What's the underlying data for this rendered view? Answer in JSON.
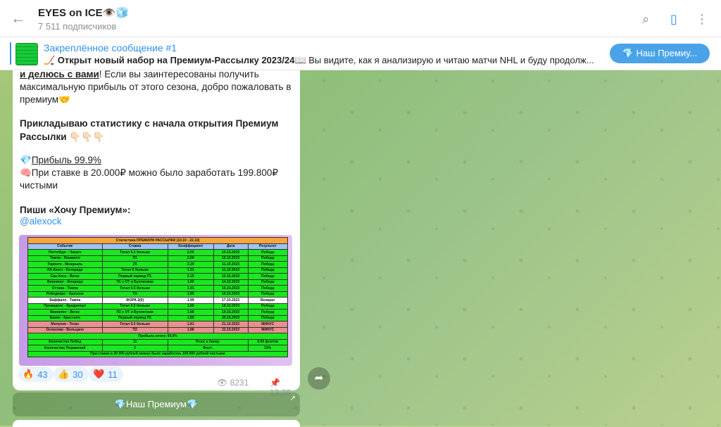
{
  "header": {
    "title": "EYES on ICE👁️🧊",
    "subscribers": "7 511 подписчиков",
    "icons": [
      "back-arrow-icon",
      "search-icon",
      "sidebar-panel-icon",
      "more-vertical-icon"
    ]
  },
  "pinned": {
    "title": "Закреплённое сообщение #1",
    "text_bold": "🏒 Открыт новый набор на Премиум-Рассылку 2023/24📖",
    "text_rest": " Вы видите, как я анализирую и читаю матчи NHL и буду продолж...",
    "button": "💎 Наш Премиу..."
  },
  "message": {
    "line1_bold": "и делюсь с вами",
    "line1_rest": "!  Если вы заинтересованы получить",
    "line2": "максимальную прибыль от этого сезона, добро пожаловать в",
    "line3": "премиум🤝",
    "line4": "Прикладываю статистику с начала открытия Премиум",
    "line5": "Рассылки 👇🏻👇🏻👇🏻",
    "profit_emoji": "💎",
    "profit_text": "Прибыль 99.9%",
    "bet_line1": "🧠При ставке в 20.000₽ можно было заработать 199.800₽",
    "bet_line2": "чистыми",
    "cta": "Пиши «Хочу Премиум»:",
    "handle": "@alexock"
  },
  "stats_table": {
    "title": "Статистика ПРЕМИУМ РАССЫЛКИ (10.10 - 22.10)",
    "columns": [
      "Событие",
      "Ставка",
      "Коэффициент",
      "Дата",
      "Результат"
    ],
    "rows": [
      {
        "event": "Питтсбург - Чикаго",
        "bet": "Тотал 6.5 больше",
        "coef": "2.00",
        "date": "10.10.2023",
        "result": "Победа",
        "kind": "g"
      },
      {
        "event": "Тампа - Нэшвилл",
        "bet": "П1",
        "coef": "2.09",
        "date": "10.10.2023",
        "result": "Победа",
        "kind": "g"
      },
      {
        "event": "Торонто - Монреаль",
        "bet": "2Х",
        "coef": "2.20",
        "date": "11.10.2023",
        "result": "Победа",
        "kind": "g"
      },
      {
        "event": "ЛА Кингз - Колорадо",
        "bet": "Тотал 6 больше",
        "coef": "1.91",
        "date": "11.10.2023",
        "result": "Победа",
        "kind": "g"
      },
      {
        "event": "Сан-Хосе - Вегас",
        "bet": "Первый период П1",
        "coef": "2.15",
        "date": "12.10.2023",
        "result": "Победа",
        "kind": "g"
      },
      {
        "event": "Виннипег - Флорида",
        "bet": "П1 с ОТ и Буллитами",
        "coef": "1.80",
        "date": "14.10.2023",
        "result": "Победа",
        "kind": "g"
      },
      {
        "event": "Оттава - Тампа",
        "bet": "Тотал 6.5 больше",
        "coef": "1.91",
        "date": "15.10.2023",
        "result": "Победа",
        "kind": "g"
      },
      {
        "event": "Рейнджерс - Аризона",
        "bet": "П1",
        "coef": "1.80",
        "date": "16.10.2023",
        "result": "Победа",
        "kind": "g"
      },
      {
        "event": "Баффало - Тампа",
        "bet": "ФОРА 2(0)",
        "coef": "1.99",
        "date": "17.10.2023",
        "result": "Возврат",
        "kind": "w"
      },
      {
        "event": "Провиденс - Бриджпорт",
        "bet": "Тотал 5.5 больше",
        "coef": "1.85",
        "date": "18.10.2023",
        "result": "Победа",
        "kind": "g"
      },
      {
        "event": "Виннипег - Вегас",
        "bet": "П2 с ОТ и Буллитами",
        "coef": "1.88",
        "date": "19.10.2023",
        "result": "Победа",
        "kind": "g"
      },
      {
        "event": "Бакин - Кристалл",
        "bet": "Первый период П1",
        "coef": "1.80",
        "date": "20.10.2023",
        "result": "Победа",
        "kind": "g"
      },
      {
        "event": "Милуоки - Техас",
        "bet": "Тотал 5.5 больше",
        "coef": "1.81",
        "date": "21.10.2023",
        "result": "МИНУС",
        "kind": "r"
      },
      {
        "event": "Оклахома - Вольцано",
        "bet": "П2",
        "coef": "1.88",
        "date": "22.10.2023",
        "result": "МИНУС",
        "kind": "r"
      }
    ],
    "profit_row": "Прибыль итого: 99.9%",
    "wins_label": "Количество Побед",
    "wins_value": "11",
    "bank_label": "Плюс к банку:",
    "bank_value": "9.99 флэтов",
    "losses_label": "Количество Поражений",
    "losses_value": "2",
    "flat_label": "Флэт:",
    "flat_value": "10%",
    "summary": "При ставке в 20 000 рублей можно было заработать 199 800 рублей чистыми"
  },
  "reactions": [
    {
      "emoji": "🔥",
      "count": "43"
    },
    {
      "emoji": "👍",
      "count": "30"
    },
    {
      "emoji": "❤️",
      "count": "11"
    }
  ],
  "meta": {
    "views": "8231",
    "time": "13:39"
  },
  "inline_button": "💎Наш Премиум💎",
  "colors": {
    "accent": "#3390ec",
    "table_green": "#19e81c",
    "table_red": "#e88f8f",
    "table_orange": "#f9a53b"
  }
}
